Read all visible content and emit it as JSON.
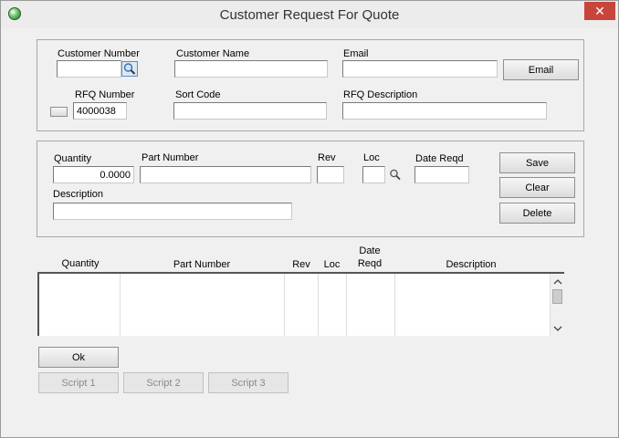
{
  "window": {
    "title": "Customer Request For Quote",
    "close_glyph": "✕",
    "icon": "app-globe-icon"
  },
  "customer_panel": {
    "customer_number_label": "Customer Number",
    "customer_number_value": "",
    "customer_name_label": "Customer Name",
    "customer_name_value": "",
    "email_label": "Email",
    "email_value": "",
    "email_button": "Email",
    "rfq_number_label": "RFQ Number",
    "rfq_number_value": "4000038",
    "sort_code_label": "Sort Code",
    "sort_code_value": "",
    "rfq_description_label": "RFQ Description",
    "rfq_description_value": ""
  },
  "line_panel": {
    "quantity_label": "Quantity",
    "quantity_value": "0.0000",
    "part_number_label": "Part Number",
    "part_number_value": "",
    "rev_label": "Rev",
    "rev_value": "",
    "loc_label": "Loc",
    "loc_value": "",
    "date_reqd_label": "Date Reqd",
    "date_reqd_value": "",
    "description_label": "Description",
    "description_value": "",
    "save_button": "Save",
    "clear_button": "Clear",
    "delete_button": "Delete"
  },
  "grid": {
    "columns": [
      "Quantity",
      "Part Number",
      "Rev",
      "Loc",
      "Date\nReqd",
      "Description"
    ],
    "rows": []
  },
  "footer": {
    "ok_button": "Ok",
    "script1_button": "Script 1",
    "script2_button": "Script 2",
    "script3_button": "Script 3"
  },
  "colors": {
    "close_button": "#c7453a",
    "window_bg": "#f0f0f0"
  }
}
